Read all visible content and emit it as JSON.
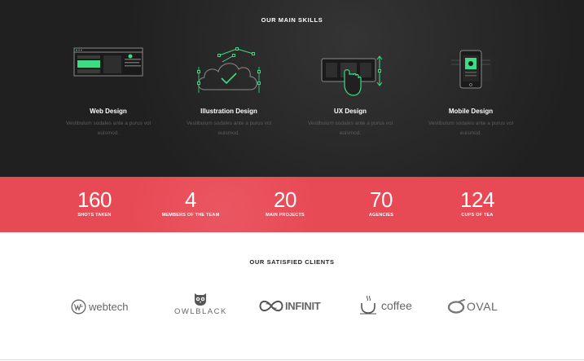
{
  "skills_section": {
    "title": "OUR MAIN SKILLS",
    "items": [
      {
        "name": "Web Design",
        "description": "Vestibulum sodales ante a purus vol euismod.",
        "icon": "browser-layout-icon"
      },
      {
        "name": "Illustration Design",
        "description": "Vestibulum sodales ante a purus vol euismod.",
        "icon": "vector-cloud-icon"
      },
      {
        "name": "UX Design",
        "description": "Vestibulum sodales ante a purus vol euismod.",
        "icon": "touch-swipe-icon"
      },
      {
        "name": "Mobile Design",
        "description": "Vestibulum sodales ante a purus vol euismod.",
        "icon": "mobile-phone-icon"
      }
    ]
  },
  "stats_section": {
    "items": [
      {
        "value": "160",
        "label": "SHOTS TAKEN"
      },
      {
        "value": "4",
        "label": "MEMBERS OF THE TEAM"
      },
      {
        "value": "20",
        "label": "MAIN PROJECTS"
      },
      {
        "value": "70",
        "label": "AGENCIES"
      },
      {
        "value": "124",
        "label": "CUPS OF TEA"
      }
    ]
  },
  "clients_section": {
    "title": "OUR SATISFIED CLIENTS",
    "logos": [
      {
        "name": "webtech",
        "icon": "webtech-logo-icon"
      },
      {
        "name": "OWLBLACK",
        "icon": "owl-logo-icon"
      },
      {
        "name": "INFINIT",
        "icon": "infinity-logo-icon"
      },
      {
        "name": "coffee",
        "icon": "coffee-cup-logo-icon"
      },
      {
        "name": "OVAL",
        "icon": "oval-logo-icon"
      }
    ]
  },
  "colors": {
    "dark_bg": "#202020",
    "accent_green": "#3ddc84",
    "stats_red": "#e84a55",
    "text_white": "#ffffff",
    "muted_text": "#5c5c5c",
    "logo_gray": "#666666"
  }
}
